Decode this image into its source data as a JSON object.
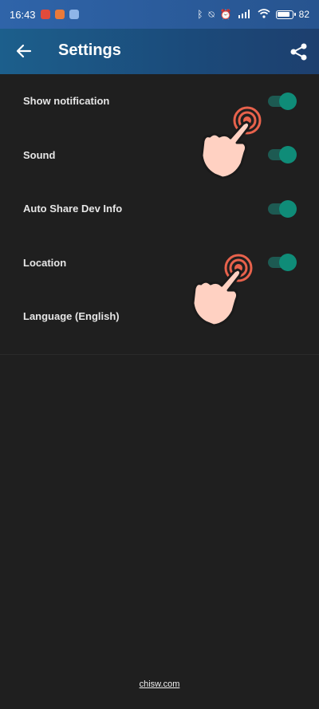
{
  "status_bar": {
    "time": "16:43",
    "battery": "82"
  },
  "app_bar": {
    "title": "Settings"
  },
  "settings": [
    {
      "label": "Show notification",
      "toggle": true
    },
    {
      "label": "Sound",
      "toggle": true
    },
    {
      "label": "Auto Share Dev Info",
      "toggle": true
    },
    {
      "label": "Location",
      "toggle": true
    },
    {
      "label": "Language (English)",
      "toggle": false
    }
  ],
  "footer": {
    "link": "chisw.com"
  },
  "colors": {
    "accent": "#0f8c78",
    "toolbar": "#1b4a7a",
    "statusbar": "#2f64a9",
    "background": "#1f1f1f",
    "tap_ring": "#e8624c",
    "hand": "#ffd1c2"
  },
  "icons": [
    "back-arrow-icon",
    "share-icon",
    "bluetooth-icon",
    "mute-icon",
    "alarm-icon",
    "signal-icon",
    "wifi-icon",
    "battery-icon",
    "tap-hand-icon"
  ]
}
